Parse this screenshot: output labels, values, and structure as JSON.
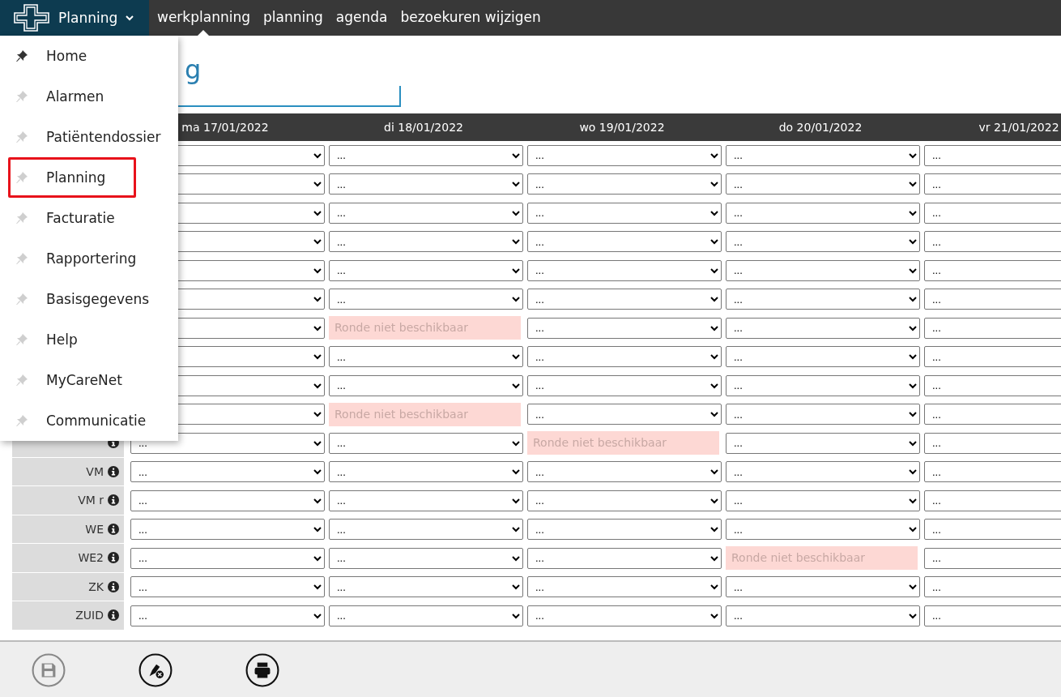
{
  "navbar": {
    "module_menu": {
      "label": "Planning"
    },
    "links": [
      {
        "label": "werkplanning",
        "selected": true
      },
      {
        "label": "planning",
        "selected": false
      },
      {
        "label": "agenda",
        "selected": false
      },
      {
        "label": "bezoekuren wijzigen",
        "selected": false
      }
    ]
  },
  "module_dropdown": {
    "items": [
      {
        "label": "Home",
        "pinned": true,
        "highlighted": false
      },
      {
        "label": "Alarmen",
        "pinned": false,
        "highlighted": false
      },
      {
        "label": "Patiëntendossier",
        "pinned": false,
        "highlighted": false
      },
      {
        "label": "Planning",
        "pinned": false,
        "highlighted": true
      },
      {
        "label": "Facturatie",
        "pinned": false,
        "highlighted": false
      },
      {
        "label": "Rapportering",
        "pinned": false,
        "highlighted": false
      },
      {
        "label": "Basisgegevens",
        "pinned": false,
        "highlighted": false
      },
      {
        "label": "Help",
        "pinned": false,
        "highlighted": false
      },
      {
        "label": "MyCareNet",
        "pinned": false,
        "highlighted": false
      },
      {
        "label": "Communicatie",
        "pinned": false,
        "highlighted": false
      }
    ]
  },
  "page_title": "g",
  "schedule": {
    "days": [
      "ma 17/01/2022",
      "di 18/01/2022",
      "wo 19/01/2022",
      "do 20/01/2022",
      "vr 21/01/2022"
    ],
    "rows": [
      {
        "cells": [
          {
            "kind": "select"
          },
          {
            "kind": "select",
            "value": "..."
          },
          {
            "kind": "select",
            "value": "..."
          },
          {
            "kind": "select",
            "value": "..."
          },
          {
            "kind": "select",
            "value": "..."
          }
        ]
      },
      {
        "cells": [
          {
            "kind": "select"
          },
          {
            "kind": "select",
            "value": "..."
          },
          {
            "kind": "select",
            "value": "..."
          },
          {
            "kind": "select",
            "value": "..."
          },
          {
            "kind": "select",
            "value": "..."
          }
        ]
      },
      {
        "cells": [
          {
            "kind": "select"
          },
          {
            "kind": "select",
            "value": "..."
          },
          {
            "kind": "select",
            "value": "..."
          },
          {
            "kind": "select",
            "value": "..."
          },
          {
            "kind": "select",
            "value": "..."
          }
        ]
      },
      {
        "cells": [
          {
            "kind": "select"
          },
          {
            "kind": "select",
            "value": "..."
          },
          {
            "kind": "select",
            "value": "..."
          },
          {
            "kind": "select",
            "value": "..."
          },
          {
            "kind": "select",
            "value": "..."
          }
        ]
      },
      {
        "cells": [
          {
            "kind": "select"
          },
          {
            "kind": "select",
            "value": "..."
          },
          {
            "kind": "select",
            "value": "..."
          },
          {
            "kind": "select",
            "value": "..."
          },
          {
            "kind": "select",
            "value": "..."
          }
        ]
      },
      {
        "cells": [
          {
            "kind": "select"
          },
          {
            "kind": "select",
            "value": "..."
          },
          {
            "kind": "select",
            "value": "..."
          },
          {
            "kind": "select",
            "value": "..."
          },
          {
            "kind": "select",
            "value": "..."
          }
        ]
      },
      {
        "cells": [
          {
            "kind": "select"
          },
          {
            "kind": "unavailable",
            "value": "Ronde niet beschikbaar"
          },
          {
            "kind": "select",
            "value": "..."
          },
          {
            "kind": "select",
            "value": "..."
          },
          {
            "kind": "select",
            "value": "..."
          }
        ]
      },
      {
        "cells": [
          {
            "kind": "select"
          },
          {
            "kind": "select",
            "value": "..."
          },
          {
            "kind": "select",
            "value": "..."
          },
          {
            "kind": "select",
            "value": "..."
          },
          {
            "kind": "select",
            "value": "..."
          }
        ]
      },
      {
        "cells": [
          {
            "kind": "select"
          },
          {
            "kind": "select",
            "value": "..."
          },
          {
            "kind": "select",
            "value": "..."
          },
          {
            "kind": "select",
            "value": "..."
          },
          {
            "kind": "select",
            "value": "..."
          }
        ]
      },
      {
        "cells": [
          {
            "kind": "select"
          },
          {
            "kind": "unavailable",
            "value": "Ronde niet beschikbaar"
          },
          {
            "kind": "select",
            "value": "..."
          },
          {
            "kind": "select",
            "value": "..."
          },
          {
            "kind": "select",
            "value": "..."
          }
        ]
      },
      {
        "info": true,
        "cells": [
          {
            "kind": "select",
            "value": "..."
          },
          {
            "kind": "select",
            "value": "..."
          },
          {
            "kind": "unavailable",
            "value": "Ronde niet beschikbaar"
          },
          {
            "kind": "select",
            "value": "..."
          },
          {
            "kind": "select",
            "value": "..."
          }
        ]
      },
      {
        "label": "VM",
        "info": true,
        "cells": [
          {
            "kind": "select",
            "value": "..."
          },
          {
            "kind": "select",
            "value": "..."
          },
          {
            "kind": "select",
            "value": "..."
          },
          {
            "kind": "select",
            "value": "..."
          },
          {
            "kind": "select",
            "value": "..."
          }
        ]
      },
      {
        "label": "VM r",
        "info": true,
        "cells": [
          {
            "kind": "select",
            "value": "..."
          },
          {
            "kind": "select",
            "value": "..."
          },
          {
            "kind": "select",
            "value": "..."
          },
          {
            "kind": "select",
            "value": "..."
          },
          {
            "kind": "select",
            "value": "..."
          }
        ]
      },
      {
        "label": "WE",
        "info": true,
        "cells": [
          {
            "kind": "select",
            "value": "..."
          },
          {
            "kind": "select",
            "value": "..."
          },
          {
            "kind": "select",
            "value": "..."
          },
          {
            "kind": "select",
            "value": "..."
          },
          {
            "kind": "select",
            "value": "..."
          }
        ]
      },
      {
        "label": "WE2",
        "info": true,
        "cells": [
          {
            "kind": "select",
            "value": "..."
          },
          {
            "kind": "select",
            "value": "..."
          },
          {
            "kind": "select",
            "value": "..."
          },
          {
            "kind": "unavailable",
            "value": "Ronde niet beschikbaar"
          },
          {
            "kind": "select",
            "value": "..."
          }
        ]
      },
      {
        "label": "ZK",
        "info": true,
        "cells": [
          {
            "kind": "select",
            "value": "..."
          },
          {
            "kind": "select",
            "value": "..."
          },
          {
            "kind": "select",
            "value": "..."
          },
          {
            "kind": "select",
            "value": "..."
          },
          {
            "kind": "select",
            "value": "..."
          }
        ]
      },
      {
        "label": "ZUID",
        "info": true,
        "cells": [
          {
            "kind": "select",
            "value": "..."
          },
          {
            "kind": "select",
            "value": "..."
          },
          {
            "kind": "select",
            "value": "..."
          },
          {
            "kind": "select",
            "value": "..."
          },
          {
            "kind": "select",
            "value": "..."
          }
        ]
      }
    ]
  },
  "toolbar": [
    {
      "kind": "save",
      "disabled": true
    },
    {
      "kind": "cancel-edit",
      "disabled": false
    },
    {
      "kind": "print",
      "disabled": false
    }
  ]
}
